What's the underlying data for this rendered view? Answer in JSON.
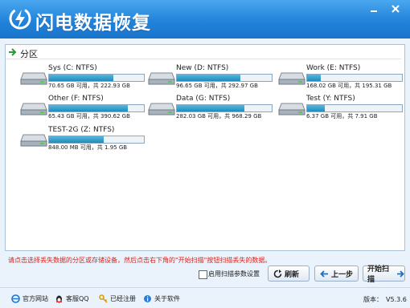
{
  "app": {
    "title": "闪电数据恢复"
  },
  "section": {
    "label": "分区"
  },
  "drives": [
    {
      "name": "Sys (C: NTFS)",
      "info": "70.65 GB 可用，共 222.93 GB",
      "used_fraction": 0.68
    },
    {
      "name": "New (D: NTFS)",
      "info": "96.65 GB 可用，共 292.97 GB",
      "used_fraction": 0.67
    },
    {
      "name": "Work (E: NTFS)",
      "info": "168.02 GB 可用，共 195.31 GB",
      "used_fraction": 0.14
    },
    {
      "name": "Other (F: NTFS)",
      "info": "65.43 GB 可用，共 390.62 GB",
      "used_fraction": 0.83
    },
    {
      "name": "Data (G: NTFS)",
      "info": "282.03 GB 可用，共 968.29 GB",
      "used_fraction": 0.71
    },
    {
      "name": "Test (Y: NTFS)",
      "info": "6.37 GB 可用，共 7.91 GB",
      "used_fraction": 0.19
    },
    {
      "name": "TEST-2G (Z: NTFS)",
      "info": "848.00 MB 可用，共 1.95 GB",
      "used_fraction": 0.58
    }
  ],
  "hint": "请点击选择丢失数据的分区或存储设备，然后点击右下角的\"开始扫描\"按钮扫描丢失的数据。",
  "options": {
    "scan_settings_label": "启用扫描参数设置",
    "scan_settings_checked": false
  },
  "buttons": {
    "refresh": "刷新",
    "back": "上一步",
    "start_scan": "开始扫描"
  },
  "status": {
    "website": "官方网站",
    "support": "客服QQ",
    "registered": "已经注册",
    "about": "关于软件",
    "version_label": "版本：",
    "version": "V5.3.6"
  },
  "colors": {
    "titlebar": "#2183da",
    "hint": "#e0201a",
    "bar_fill": "#1f8bbd"
  }
}
